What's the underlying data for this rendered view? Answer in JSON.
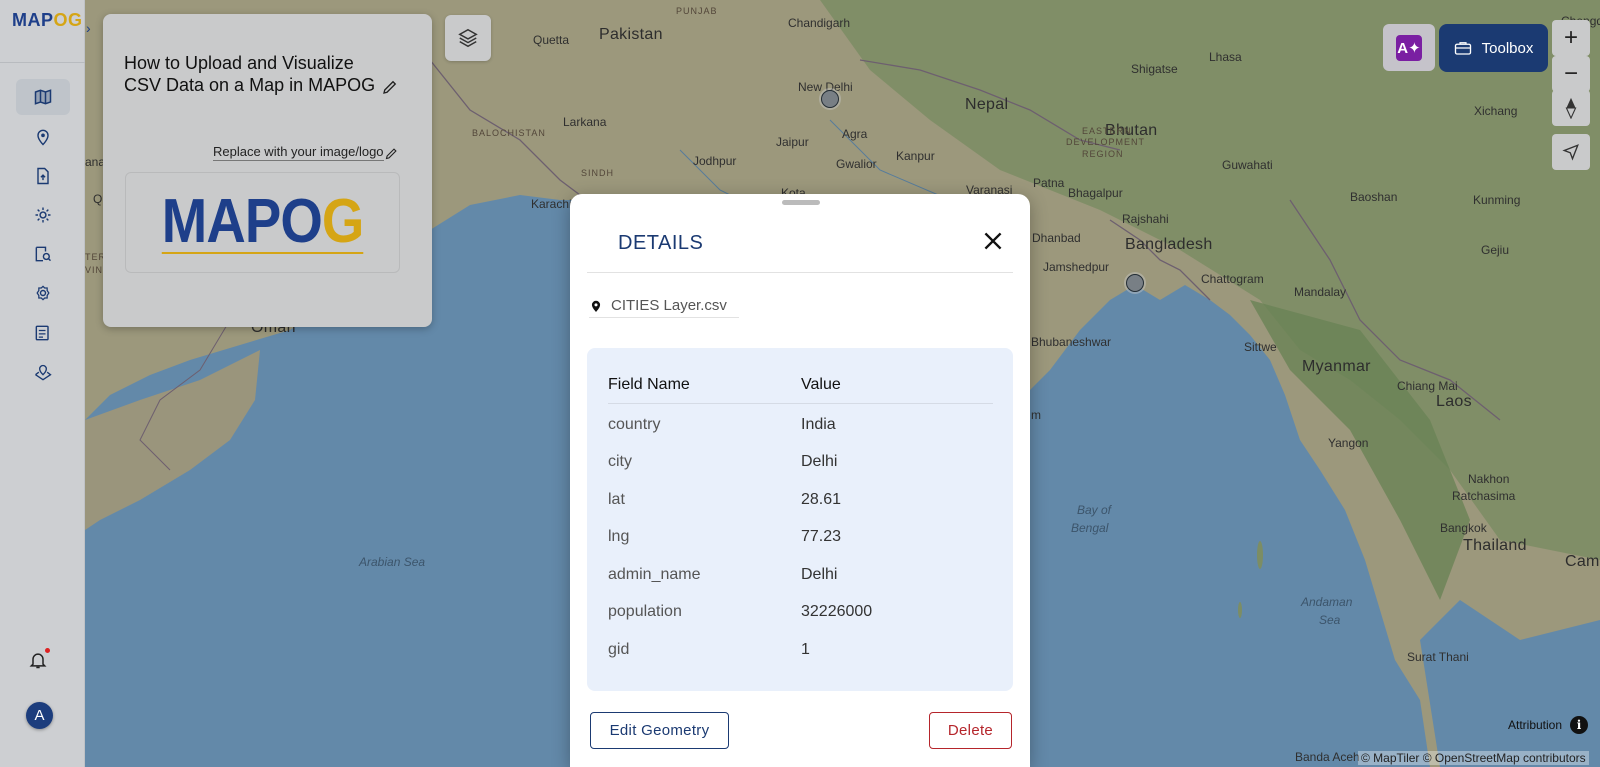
{
  "app": {
    "logo_text_a": "MAP",
    "logo_text_b": "OG"
  },
  "rail": {
    "items": [
      {
        "name": "map-icon",
        "active": true
      },
      {
        "name": "location-pin-icon",
        "active": false
      },
      {
        "name": "upload-file-icon",
        "active": false
      },
      {
        "name": "gear-icon",
        "active": false
      },
      {
        "name": "map-search-icon",
        "active": false
      },
      {
        "name": "settings-cog-icon",
        "active": false
      },
      {
        "name": "report-list-icon",
        "active": false
      },
      {
        "name": "map-marker-layers-icon",
        "active": false
      }
    ],
    "avatar_letter": "A"
  },
  "info_card": {
    "title": "How to Upload and Visualize CSV Data on a Map in MAPOG",
    "logo_hint": "Replace with your image/logo",
    "logo_a": "MAP",
    "logo_o": "O",
    "logo_g": "G"
  },
  "toolbar": {
    "ai_label": "A✦",
    "toolbox_label": "Toolbox",
    "zoom_in": "+",
    "zoom_out": "−"
  },
  "map": {
    "labels": [
      {
        "text": "Pakistan",
        "kind": "country"
      },
      {
        "text": "Nepal",
        "kind": "country"
      },
      {
        "text": "Bhutan",
        "kind": "country"
      },
      {
        "text": "Bangladesh",
        "kind": "country"
      },
      {
        "text": "Myanmar",
        "kind": "country"
      },
      {
        "text": "Laos",
        "kind": "country"
      },
      {
        "text": "Thailand",
        "kind": "country"
      },
      {
        "text": "Oman",
        "kind": "country"
      },
      {
        "text": "Camb",
        "kind": "country"
      },
      {
        "text": "Arabian Sea",
        "kind": "water"
      },
      {
        "text": "Bay of",
        "kind": "water"
      },
      {
        "text": "Bengal",
        "kind": "water"
      },
      {
        "text": "Andaman",
        "kind": "water"
      },
      {
        "text": "Sea",
        "kind": "water"
      },
      {
        "text": "BALOCHISTAN",
        "kind": "region"
      },
      {
        "text": "SINDH",
        "kind": "region"
      },
      {
        "text": "PUNJAB",
        "kind": "region"
      },
      {
        "text": "EASTERN",
        "kind": "region"
      },
      {
        "text": "DEVELOPMENT",
        "kind": "region"
      },
      {
        "text": "REGION",
        "kind": "region"
      },
      {
        "text": "Quetta",
        "kind": "city"
      },
      {
        "text": "Larkana",
        "kind": "city"
      },
      {
        "text": "Karachi",
        "kind": "city"
      },
      {
        "text": "Chandigarh",
        "kind": "city"
      },
      {
        "text": "New Delhi",
        "kind": "city"
      },
      {
        "text": "Jaipur",
        "kind": "city"
      },
      {
        "text": "Agra",
        "kind": "city"
      },
      {
        "text": "Jodhpur",
        "kind": "city"
      },
      {
        "text": "Gwalior",
        "kind": "city"
      },
      {
        "text": "Kanpur",
        "kind": "city"
      },
      {
        "text": "Varanasi",
        "kind": "city"
      },
      {
        "text": "Patna",
        "kind": "city"
      },
      {
        "text": "Bhagalpur",
        "kind": "city"
      },
      {
        "text": "Rajshahi",
        "kind": "city"
      },
      {
        "text": "Dhanbad",
        "kind": "city"
      },
      {
        "text": "Jamshedpur",
        "kind": "city"
      },
      {
        "text": "Chattogram",
        "kind": "city"
      },
      {
        "text": "Bhubaneshwar",
        "kind": "city"
      },
      {
        "text": "Guwahati",
        "kind": "city"
      },
      {
        "text": "Shigatse",
        "kind": "city"
      },
      {
        "text": "Lhasa",
        "kind": "city"
      },
      {
        "text": "Xichang",
        "kind": "city"
      },
      {
        "text": "Baoshan",
        "kind": "city"
      },
      {
        "text": "Kunming",
        "kind": "city"
      },
      {
        "text": "Gejiu",
        "kind": "city"
      },
      {
        "text": "Mandalay",
        "kind": "city"
      },
      {
        "text": "Sittwe",
        "kind": "city"
      },
      {
        "text": "Yangon",
        "kind": "city"
      },
      {
        "text": "Chiang Mai",
        "kind": "city"
      },
      {
        "text": "Nakhon",
        "kind": "city"
      },
      {
        "text": "Ratchasima",
        "kind": "city"
      },
      {
        "text": "Bangkok",
        "kind": "city"
      },
      {
        "text": "Surat Thani",
        "kind": "city"
      },
      {
        "text": "Banda Aceh",
        "kind": "city"
      },
      {
        "text": "Chengd",
        "kind": "city"
      },
      {
        "text": "Kota",
        "kind": "city"
      },
      {
        "text": "ana",
        "kind": "city"
      },
      {
        "text": "Q",
        "kind": "city"
      },
      {
        "text": "TER",
        "kind": "region"
      },
      {
        "text": "VIN",
        "kind": "region"
      },
      {
        "text": "m",
        "kind": "city"
      }
    ],
    "attribution_label": "Attribution",
    "attribution_info": "i",
    "copyright": "© MapTiler © OpenStreetMap contributors"
  },
  "details": {
    "title": "DETAILS",
    "layer_name": "CITIES Layer.csv",
    "header_field": "Field Name",
    "header_value": "Value",
    "rows": [
      {
        "field": "country",
        "value": "India"
      },
      {
        "field": "city",
        "value": "Delhi"
      },
      {
        "field": "lat",
        "value": "28.61"
      },
      {
        "field": "lng",
        "value": "77.23"
      },
      {
        "field": "admin_name",
        "value": "Delhi"
      },
      {
        "field": "population",
        "value": "32226000"
      },
      {
        "field": "gid",
        "value": "1"
      }
    ],
    "edit_label": "Edit Geometry",
    "delete_label": "Delete"
  },
  "colors": {
    "brand_blue": "#1b3a72",
    "brand_yellow": "#d5a515",
    "danger": "#b5252b",
    "sea": "#7fb0d9"
  }
}
